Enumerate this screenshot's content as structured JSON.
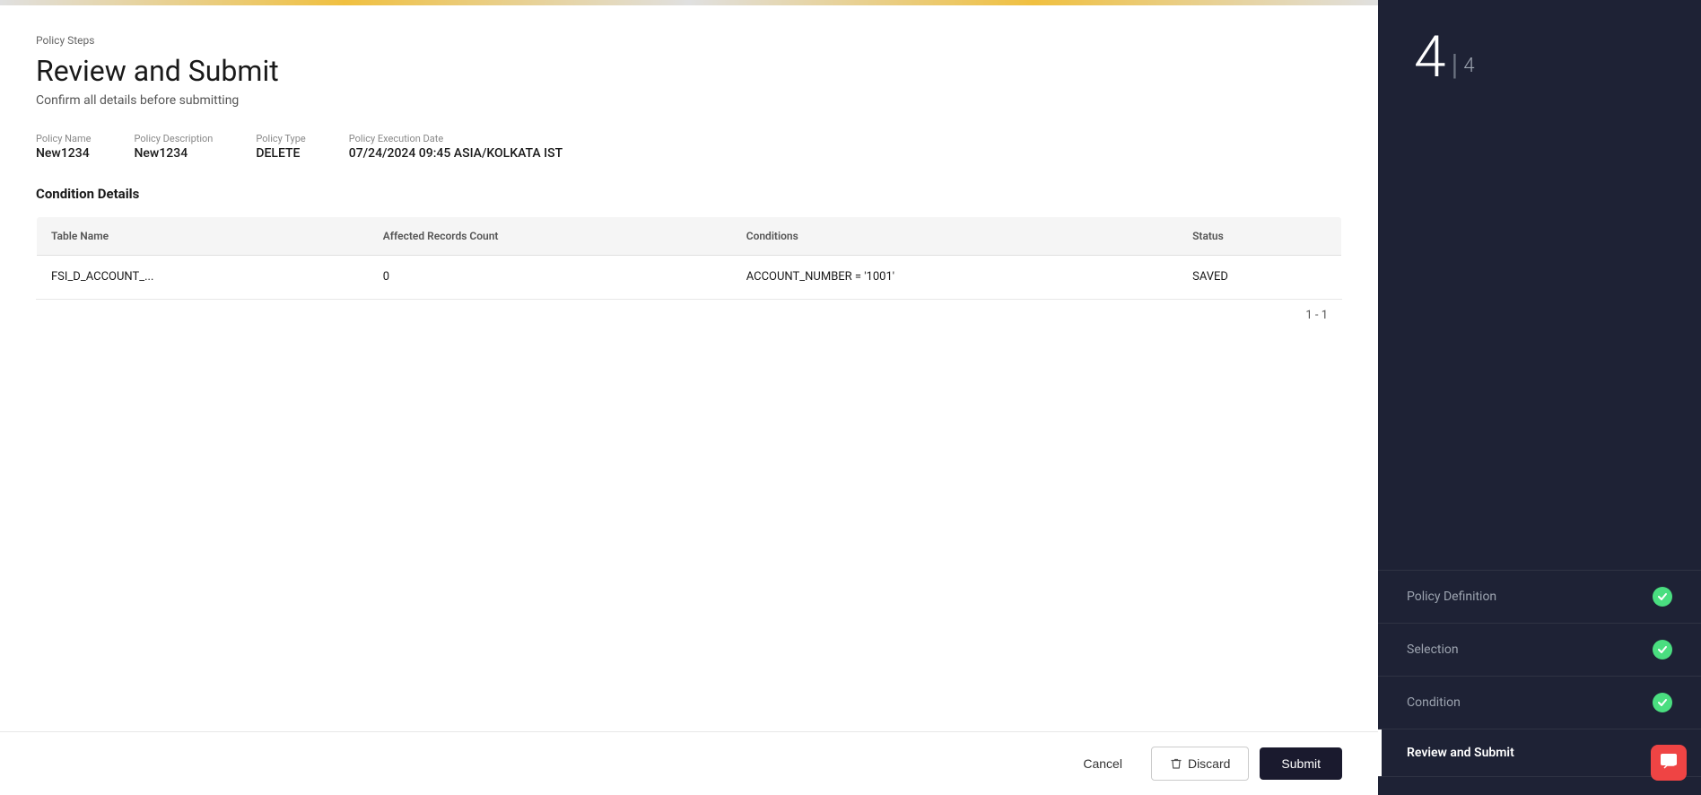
{
  "topBar": {
    "label": "Policy Steps"
  },
  "header": {
    "title": "Review and Submit",
    "subtitle": "Confirm all details before submitting"
  },
  "policyMeta": {
    "nameLabel": "Policy Name",
    "nameValue": "New1234",
    "descLabel": "Policy Description",
    "descValue": "New1234",
    "typeLabel": "Policy Type",
    "typeValue": "DELETE",
    "execLabel": "Policy Execution Date",
    "execValue": "07/24/2024 09:45 ASIA/KOLKATA IST"
  },
  "conditionDetails": {
    "sectionTitle": "Condition Details",
    "table": {
      "columns": [
        {
          "key": "tableName",
          "label": "Table Name"
        },
        {
          "key": "affectedCount",
          "label": "Affected Records Count"
        },
        {
          "key": "conditions",
          "label": "Conditions"
        },
        {
          "key": "status",
          "label": "Status"
        }
      ],
      "rows": [
        {
          "tableName": "FSI_D_ACCOUNT_...",
          "affectedCount": "0",
          "conditions": "ACCOUNT_NUMBER = '1001'",
          "status": "SAVED"
        }
      ],
      "pagination": "1 - 1"
    }
  },
  "footer": {
    "cancelLabel": "Cancel",
    "discardLabel": "Discard",
    "submitLabel": "Submit"
  },
  "sidebar": {
    "stepCurrent": "4",
    "stepDivider": "|",
    "stepTotal": "4",
    "steps": [
      {
        "id": "policy-definition",
        "label": "Policy Definition",
        "completed": true,
        "active": false
      },
      {
        "id": "selection",
        "label": "Selection",
        "completed": true,
        "active": false
      },
      {
        "id": "condition",
        "label": "Condition",
        "completed": true,
        "active": false
      },
      {
        "id": "review-and-submit",
        "label": "Review and Submit",
        "completed": false,
        "active": true
      }
    ]
  },
  "chatBubble": {
    "icon": "💬"
  }
}
